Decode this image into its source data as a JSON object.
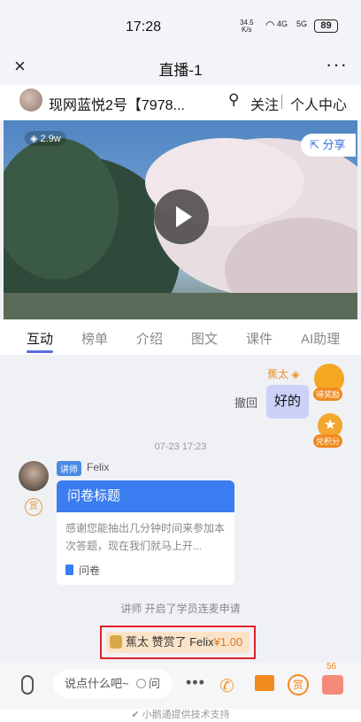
{
  "status": {
    "time": "17:28",
    "net_speed": "34.5",
    "net_unit": "K/s",
    "signal1": "4G",
    "signal2": "5G",
    "battery": "89"
  },
  "titlebar": {
    "close_label": "×",
    "title": "直播-1",
    "more_label": "···"
  },
  "host": {
    "name": "现网蓝悦2号【7978...",
    "follow_label": "关注",
    "center_label": "个人中心"
  },
  "video": {
    "views": "2.9w",
    "share_label": "分享"
  },
  "tabs": [
    "互动",
    "榜单",
    "介绍",
    "图文",
    "课件",
    "AI助理"
  ],
  "active_tab": 0,
  "chat": {
    "self_name": "蕉太",
    "withdraw_label": "撤回",
    "self_message": "好的",
    "reward_label": "得奖励",
    "points_label": "兑积分",
    "timestamp": "07-23 17:23",
    "teacher_role": "讲师",
    "teacher_name": "Felix",
    "tip_label": "赏",
    "survey_title": "问卷标题",
    "survey_desc": "感谢您能抽出几分钟时间来参加本次答题，现在我们就马上开...",
    "survey_type": "问卷",
    "system_message": "讲师 开启了学员连麦申请",
    "gift_text": "蕉太 赞赏了 Felix",
    "gift_amount": "¥1.00"
  },
  "bottombar": {
    "input_placeholder": "说点什么吧~",
    "ask_label": "问",
    "tip_label": "赏",
    "like_count": "56"
  },
  "footer": {
    "powered_by": "小鹅通提供技术支持"
  },
  "colors": {
    "accent": "#5a6be0",
    "brand_blue": "#3a7df0",
    "orange": "#f28a1e",
    "highlight_border": "#e5202a"
  }
}
